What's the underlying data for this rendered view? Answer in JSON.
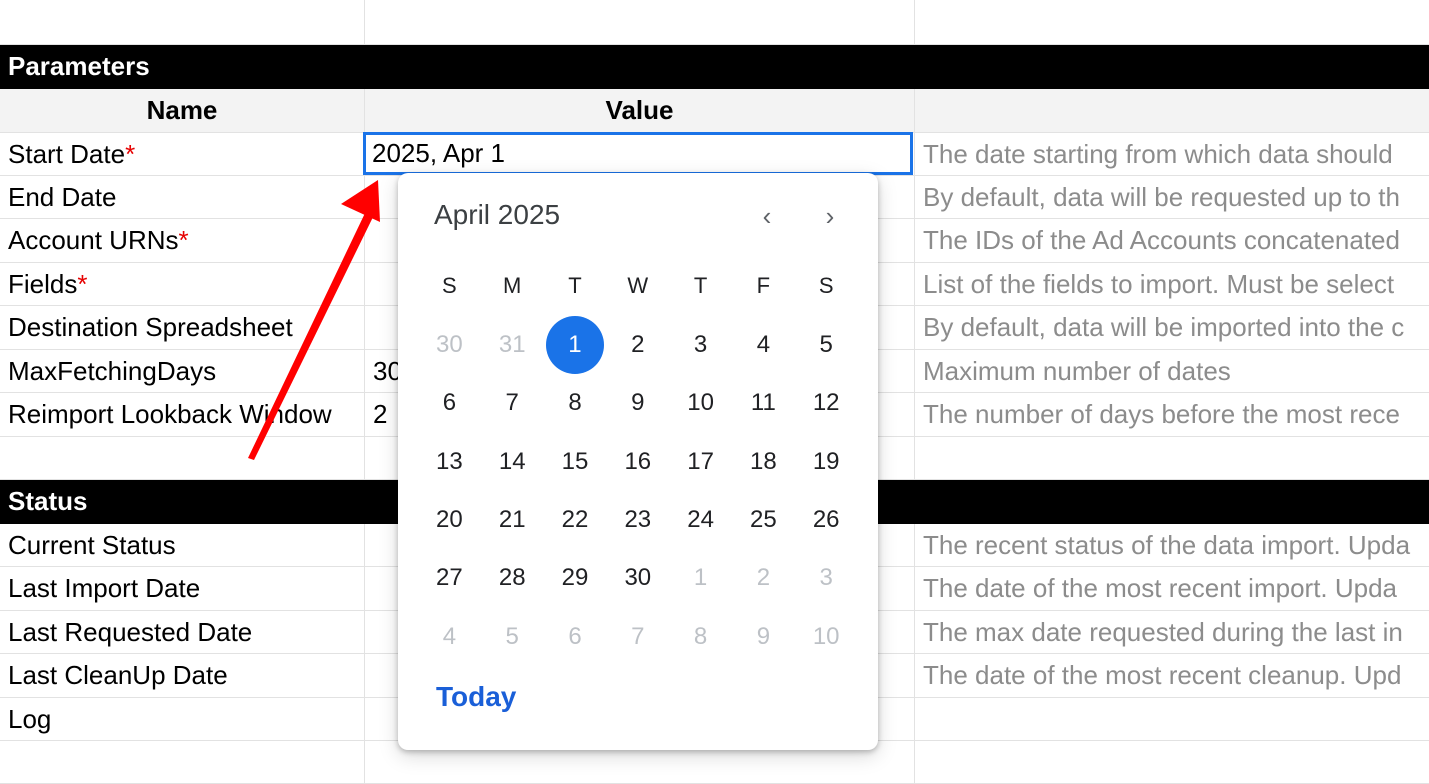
{
  "sheet": {
    "parameters_section": "Parameters",
    "header": {
      "name": "Name",
      "value": "Value"
    },
    "rows": [
      {
        "name": "Start Date",
        "required": "*",
        "value": "",
        "desc": "The date starting from which data should"
      },
      {
        "name": "End Date",
        "required": "",
        "value": "",
        "desc": "By default, data will be requested up to th"
      },
      {
        "name": "Account URNs",
        "required": "*",
        "value": "",
        "desc": "The IDs of the Ad Accounts concatenated"
      },
      {
        "name": "Fields",
        "required": "*",
        "value": "",
        "desc": "List of the fields to import. Must be select"
      },
      {
        "name": "Destination Spreadsheet",
        "required": "",
        "value": "",
        "desc": "By default, data will be imported into the c"
      },
      {
        "name": "MaxFetchingDays",
        "required": "",
        "value": "30",
        "desc": "Maximum number of dates"
      },
      {
        "name": "Reimport Lookback Window",
        "required": "",
        "value": "2",
        "desc": "The number of days before the most rece"
      }
    ],
    "status_section": "Status",
    "status_rows": [
      {
        "name": "Current Status",
        "desc": "The recent status of the data import. Upda"
      },
      {
        "name": "Last Import Date",
        "desc": "The date of the most recent import. Upda"
      },
      {
        "name": "Last Requested Date",
        "desc": "The max date requested during the last in"
      },
      {
        "name": "Last CleanUp Date",
        "desc": "The date of the most recent cleanup. Upd"
      },
      {
        "name": "Log",
        "desc": ""
      }
    ]
  },
  "selected_cell": {
    "value": "2025, Apr 1"
  },
  "datepicker": {
    "title": "April 2025",
    "prev_icon": "chevron-left-icon",
    "next_icon": "chevron-right-icon",
    "prev_glyph": "‹",
    "next_glyph": "›",
    "weekdays": [
      "S",
      "M",
      "T",
      "W",
      "T",
      "F",
      "S"
    ],
    "weeks": [
      [
        "30",
        "31",
        "1",
        "2",
        "3",
        "4",
        "5"
      ],
      [
        "6",
        "7",
        "8",
        "9",
        "10",
        "11",
        "12"
      ],
      [
        "13",
        "14",
        "15",
        "16",
        "17",
        "18",
        "19"
      ],
      [
        "20",
        "21",
        "22",
        "23",
        "24",
        "25",
        "26"
      ],
      [
        "27",
        "28",
        "29",
        "30",
        "1",
        "2",
        "3"
      ],
      [
        "4",
        "5",
        "6",
        "7",
        "8",
        "9",
        "10"
      ]
    ],
    "out_of_month": [
      [
        0,
        0
      ],
      [
        0,
        1
      ],
      [
        4,
        4
      ],
      [
        4,
        5
      ],
      [
        4,
        6
      ],
      [
        5,
        0
      ],
      [
        5,
        1
      ],
      [
        5,
        2
      ],
      [
        5,
        3
      ],
      [
        5,
        4
      ],
      [
        5,
        5
      ],
      [
        5,
        6
      ]
    ],
    "selected": [
      0,
      2
    ],
    "today_label": "Today",
    "selected_color": "#1a73e8"
  },
  "colors": {
    "accent": "#1a73e8",
    "required": "#e60000",
    "annotation_arrow": "#ff0000",
    "section_bg": "#000000"
  }
}
